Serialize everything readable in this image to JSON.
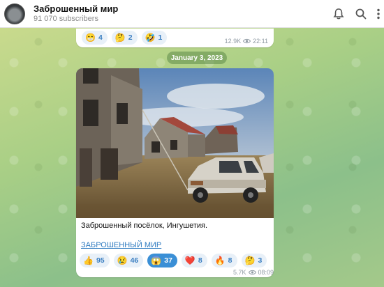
{
  "channel": {
    "name": "Заброшенный мир",
    "subscribers": "91 070 subscribers"
  },
  "header_icons": [
    "bell-icon",
    "search-icon",
    "more-vertical-icon"
  ],
  "prev_message": {
    "reactions": [
      {
        "emoji": "😁",
        "count": "4"
      },
      {
        "emoji": "🤔",
        "count": "2"
      },
      {
        "emoji": "🤣",
        "count": "1"
      }
    ],
    "views": "12.9K",
    "time": "22:11"
  },
  "date_separator": "January 3, 2023",
  "post": {
    "caption": "Заброшенный посёлок, Ингушетия.",
    "link_text": "ЗАБРОШЕННЫЙ МИР",
    "reactions": [
      {
        "emoji": "👍",
        "count": "95",
        "active": false
      },
      {
        "emoji": "😢",
        "count": "46",
        "active": false
      },
      {
        "emoji": "😱",
        "count": "37",
        "active": true
      },
      {
        "emoji": "❤️",
        "count": "8",
        "active": false
      },
      {
        "emoji": "🔥",
        "count": "8",
        "active": false
      },
      {
        "emoji": "🤔",
        "count": "3",
        "active": false
      }
    ],
    "views": "5.7K",
    "time": "08:09"
  },
  "colors": {
    "accent": "#3a8fd6",
    "link": "#2f7bc0",
    "reaction_bg": "#e8f0f8"
  }
}
